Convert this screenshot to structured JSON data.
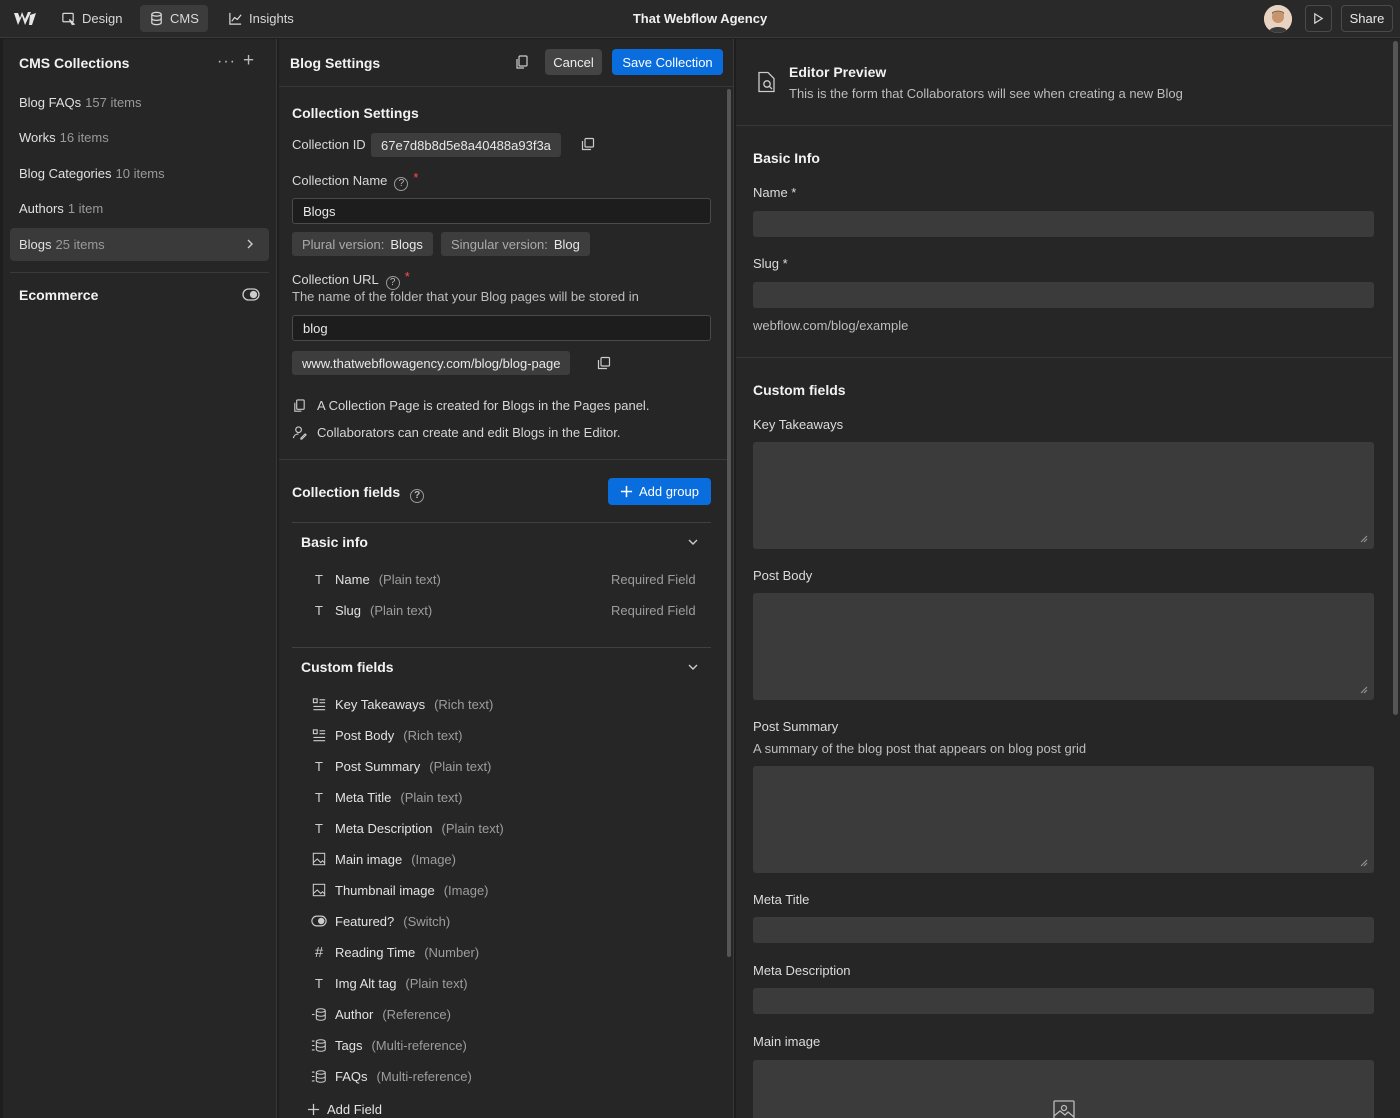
{
  "topbar": {
    "design_label": "Design",
    "cms_label": "CMS",
    "insights_label": "Insights",
    "title": "That Webflow Agency",
    "share_label": "Share"
  },
  "sidebar": {
    "title": "CMS Collections",
    "more_label": "···",
    "add_label": "+",
    "items": [
      {
        "name": "Blog FAQs",
        "count": "157 items"
      },
      {
        "name": "Works",
        "count": "16 items"
      },
      {
        "name": "Blog Categories",
        "count": "10 items"
      },
      {
        "name": "Authors",
        "count": "1 item"
      },
      {
        "name": "Blogs",
        "count": "25 items"
      }
    ],
    "ecommerce_label": "Ecommerce"
  },
  "settings": {
    "title": "Blog Settings",
    "cancel_label": "Cancel",
    "save_label": "Save Collection",
    "section_title": "Collection Settings",
    "collection_id_label": "Collection ID",
    "collection_id": "67e7d8b8d5e8a40488a93f3a",
    "name_label": "Collection Name",
    "name_value": "Blogs",
    "plural_label": "Plural version:",
    "plural_value": "Blogs",
    "singular_label": "Singular version:",
    "singular_value": "Blog",
    "url_label": "Collection URL",
    "url_hint": "The name of the folder that your Blog pages will be stored in",
    "url_value": "blog",
    "full_url": "www.thatwebflowagency.com/blog/blog-page",
    "note_page": "A Collection Page is created for Blogs in the Pages panel.",
    "note_collab": "Collaborators can create and edit Blogs in the Editor.",
    "fields_title": "Collection fields",
    "add_group_label": "Add group",
    "basic_group": "Basic info",
    "basic_fields": [
      {
        "name": "Name",
        "type": "(Plain text)",
        "status": "Required Field"
      },
      {
        "name": "Slug",
        "type": "(Plain text)",
        "status": "Required Field"
      }
    ],
    "custom_group": "Custom fields",
    "custom_fields": [
      {
        "name": "Key Takeaways",
        "type": "(Rich text)",
        "icon": "rich-text-icon"
      },
      {
        "name": "Post Body",
        "type": "(Rich text)",
        "icon": "rich-text-icon"
      },
      {
        "name": "Post Summary",
        "type": "(Plain text)",
        "icon": "text-icon"
      },
      {
        "name": "Meta Title",
        "type": "(Plain text)",
        "icon": "text-icon"
      },
      {
        "name": "Meta Description",
        "type": "(Plain text)",
        "icon": "text-icon"
      },
      {
        "name": "Main image",
        "type": "(Image)",
        "icon": "image-icon"
      },
      {
        "name": "Thumbnail image",
        "type": "(Image)",
        "icon": "image-icon"
      },
      {
        "name": "Featured?",
        "type": "(Switch)",
        "icon": "switch-icon"
      },
      {
        "name": "Reading Time",
        "type": "(Number)",
        "icon": "number-icon"
      },
      {
        "name": "Img Alt tag",
        "type": "(Plain text)",
        "icon": "text-icon"
      },
      {
        "name": "Author",
        "type": "(Reference)",
        "icon": "reference-icon"
      },
      {
        "name": "Tags",
        "type": "(Multi-reference)",
        "icon": "multi-reference-icon"
      },
      {
        "name": "FAQs",
        "type": "(Multi-reference)",
        "icon": "multi-reference-icon"
      }
    ],
    "add_field_label": "Add Field"
  },
  "preview": {
    "title": "Editor Preview",
    "subtitle": "This is the form that Collaborators will see when creating a new Blog",
    "basic_title": "Basic Info",
    "name_label": "Name *",
    "slug_label": "Slug *",
    "slug_hint": "webflow.com/blog/example",
    "custom_title": "Custom fields",
    "key_takeaways": "Key Takeaways",
    "post_body": "Post Body",
    "post_summary": "Post Summary",
    "post_summary_desc": "A summary of the blog post that appears on blog post grid",
    "meta_title": "Meta Title",
    "meta_description": "Meta Description",
    "main_image": "Main image"
  },
  "colors": {
    "accent": "#0a6dde",
    "required": "#ff4e4e",
    "background": "#262626"
  }
}
